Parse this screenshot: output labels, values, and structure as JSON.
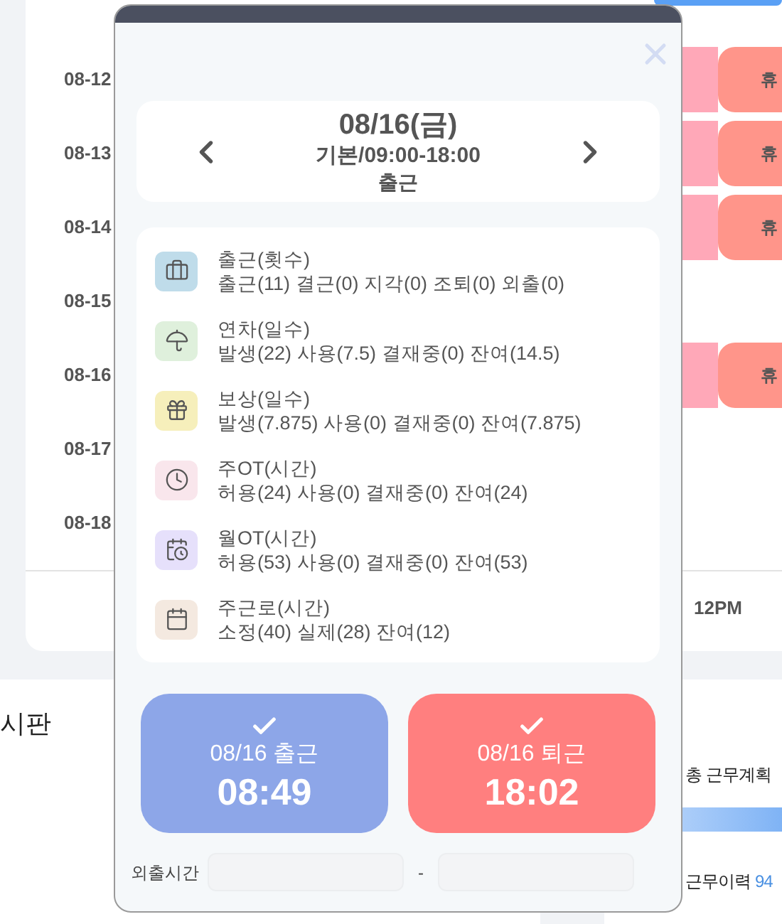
{
  "timeline": {
    "rows": [
      {
        "date": "08-12",
        "block": {
          "label": "휴"
        }
      },
      {
        "date": "08-13",
        "block": {
          "label": "휴"
        }
      },
      {
        "date": "08-14",
        "block": {
          "label": "휴"
        }
      },
      {
        "date": "08-15"
      },
      {
        "date": "08-16",
        "block": {
          "label": "휴"
        }
      },
      {
        "date": "08-17"
      },
      {
        "date": "08-18"
      }
    ],
    "axis_label": "12PM"
  },
  "board_title": "시판",
  "plan_title": "총 근무계획",
  "history": {
    "label": "근무이력",
    "value": "94"
  },
  "modal": {
    "date": "08/16(금)",
    "schedule": "기본/09:00-18:00",
    "status": "출근",
    "stats": [
      {
        "kind": "briefcase",
        "color": "#bfdcea",
        "title": "출근(횟수)",
        "detail": "출근(11) 결근(0) 지각(0) 조퇴(0) 외출(0)"
      },
      {
        "kind": "umbrella",
        "color": "#dff0dc",
        "title": "연차(일수)",
        "detail": "발생(22) 사용(7.5) 결재중(0) 잔여(14.5)"
      },
      {
        "kind": "gift",
        "color": "#f6efbb",
        "title": "보상(일수)",
        "detail": "발생(7.875) 사용(0) 결재중(0) 잔여(7.875)"
      },
      {
        "kind": "clock",
        "color": "#f9e6ec",
        "title": "주OT(시간)",
        "detail": "허용(24) 사용(0) 결재중(0) 잔여(24)"
      },
      {
        "kind": "calendar-clock",
        "color": "#e6e0fb",
        "title": "월OT(시간)",
        "detail": "허용(53) 사용(0) 결재중(0) 잔여(53)"
      },
      {
        "kind": "calendar",
        "color": "#f4e9e0",
        "title": "주근로(시간)",
        "detail": "소정(40) 실제(28) 잔여(12)"
      }
    ],
    "punches": [
      {
        "kind": "in",
        "label": "08/16 출근",
        "time": "08:49"
      },
      {
        "kind": "out",
        "label": "08/16 퇴근",
        "time": "18:02"
      }
    ],
    "outing": {
      "label": "외출시간",
      "separator": "-"
    }
  }
}
